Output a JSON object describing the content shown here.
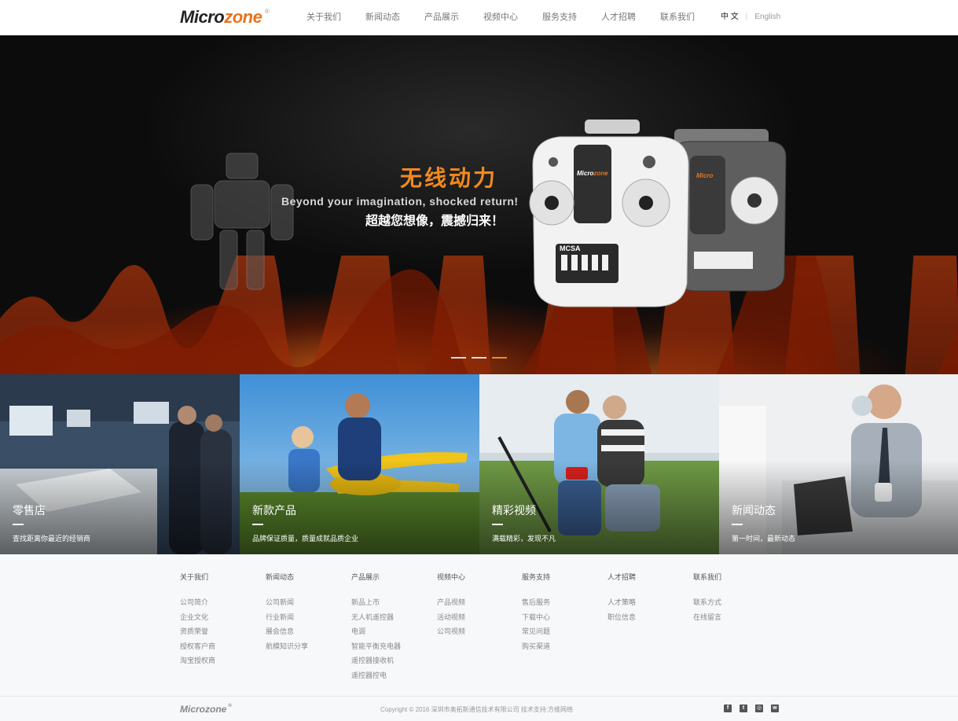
{
  "header": {
    "logo": {
      "micro": "Micro",
      "zone": "zone",
      "reg": "®"
    },
    "nav": [
      "关于我们",
      "新闻动态",
      "产品展示",
      "视频中心",
      "服务支持",
      "人才招聘",
      "联系我们"
    ],
    "lang": {
      "cn": "中 文",
      "sep": "|",
      "en": "English"
    }
  },
  "hero": {
    "title": "无线动力",
    "subtitle_en": "Beyond your imagination, shocked return!",
    "subtitle_cn": "超越您想像，震撼归来！",
    "carousel": {
      "slides": 3,
      "active_index": 3
    }
  },
  "tiles": [
    {
      "title": "零售店",
      "desc": "查找距离你最近的经销商"
    },
    {
      "title": "新款产品",
      "desc": "品牌保证质量，质量成就品质企业"
    },
    {
      "title": "精彩视频",
      "desc": "满载精彩，发现不凡"
    },
    {
      "title": "新闻动态",
      "desc": "第一时间，最新动态"
    }
  ],
  "footer": {
    "columns": [
      {
        "heading": "关于我们",
        "items": [
          "公司简介",
          "企业文化",
          "资质荣誉",
          "授权客户商",
          "淘宝授权商"
        ]
      },
      {
        "heading": "新闻动态",
        "items": [
          "公司新闻",
          "行业新闻",
          "展会信息",
          "航模知识分享"
        ]
      },
      {
        "heading": "产品展示",
        "items": [
          "新品上市",
          "无人机遥控器",
          "电调",
          "智能平衡充电器",
          "遥控器接收机",
          "遥控器控电"
        ]
      },
      {
        "heading": "视频中心",
        "items": [
          "产品视频",
          "活动视频",
          "公司视频"
        ]
      },
      {
        "heading": "服务支持",
        "items": [
          "售后服务",
          "下载中心",
          "常见问题",
          "购买渠道"
        ]
      },
      {
        "heading": "人才招聘",
        "items": [
          "人才策略",
          "职位信息"
        ]
      },
      {
        "heading": "联系我们",
        "items": [
          "联系方式",
          "在线留言"
        ]
      }
    ]
  },
  "bottom": {
    "logo": "Microzone",
    "reg": "®",
    "copyright": "Copyright © 2016 深圳市奥拓斯通信技术有限公司 技术支持:方维网络",
    "social": [
      {
        "icon": "facebook-icon",
        "glyph": "f"
      },
      {
        "icon": "twitter-icon",
        "glyph": "t"
      },
      {
        "icon": "wechat-icon",
        "glyph": "◎"
      },
      {
        "icon": "weibo-icon",
        "glyph": "w"
      }
    ]
  }
}
